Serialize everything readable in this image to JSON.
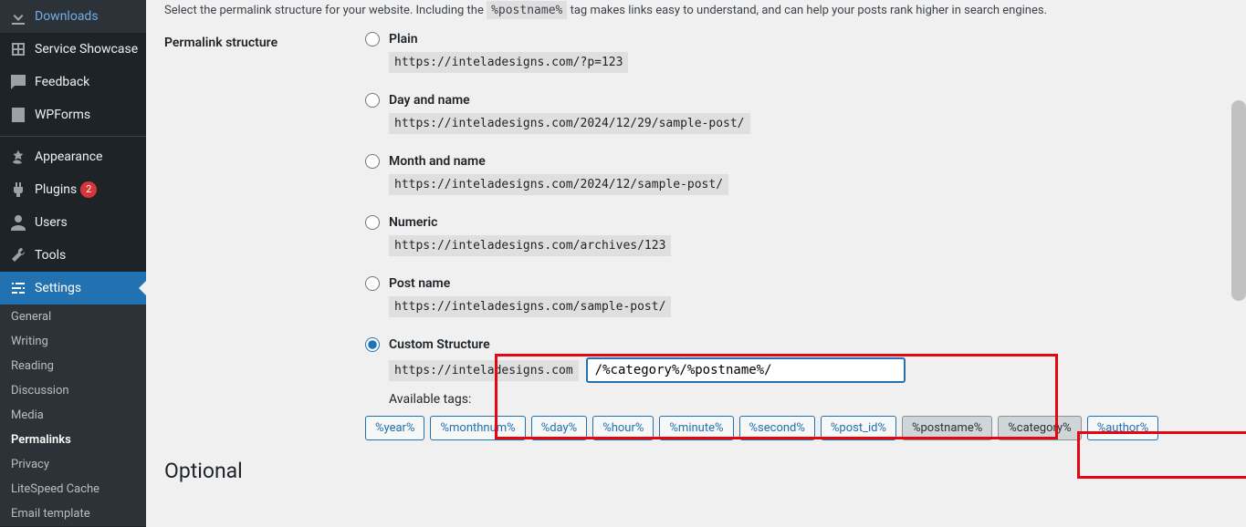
{
  "sidebar": {
    "items": [
      {
        "label": "Downloads",
        "icon": "download"
      },
      {
        "label": "Service Showcase",
        "icon": "showcase"
      },
      {
        "label": "Feedback",
        "icon": "feedback"
      },
      {
        "label": "WPForms",
        "icon": "forms"
      },
      {
        "label": "Appearance",
        "icon": "appearance"
      },
      {
        "label": "Plugins",
        "icon": "plugins",
        "badge": "2"
      },
      {
        "label": "Users",
        "icon": "users"
      },
      {
        "label": "Tools",
        "icon": "tools"
      },
      {
        "label": "Settings",
        "icon": "settings",
        "active": true
      }
    ],
    "submenu": [
      "General",
      "Writing",
      "Reading",
      "Discussion",
      "Media",
      "Permalinks",
      "Privacy",
      "LiteSpeed Cache",
      "Email template"
    ],
    "submenu_current": "Permalinks"
  },
  "intro": {
    "text_before": "Select the permalink structure for your website. Including the ",
    "code": "%postname%",
    "text_after": " tag makes links easy to understand, and can help your posts rank higher in search engines."
  },
  "structure": {
    "label": "Permalink structure",
    "options": [
      {
        "name": "Plain",
        "example": "https://inteladesigns.com/?p=123"
      },
      {
        "name": "Day and name",
        "example": "https://inteladesigns.com/2024/12/29/sample-post/"
      },
      {
        "name": "Month and name",
        "example": "https://inteladesigns.com/2024/12/sample-post/"
      },
      {
        "name": "Numeric",
        "example": "https://inteladesigns.com/archives/123"
      },
      {
        "name": "Post name",
        "example": "https://inteladesigns.com/sample-post/"
      }
    ],
    "custom": {
      "label": "Custom Structure",
      "base": "https://inteladesigns.com",
      "value": "/%category%/%postname%/",
      "available_label": "Available tags:",
      "tags": [
        "%year%",
        "%monthnum%",
        "%day%",
        "%hour%",
        "%minute%",
        "%second%",
        "%post_id%",
        "%postname%",
        "%category%",
        "%author%"
      ],
      "selected_tags": [
        "%postname%",
        "%category%"
      ]
    }
  },
  "optional_heading": "Optional"
}
